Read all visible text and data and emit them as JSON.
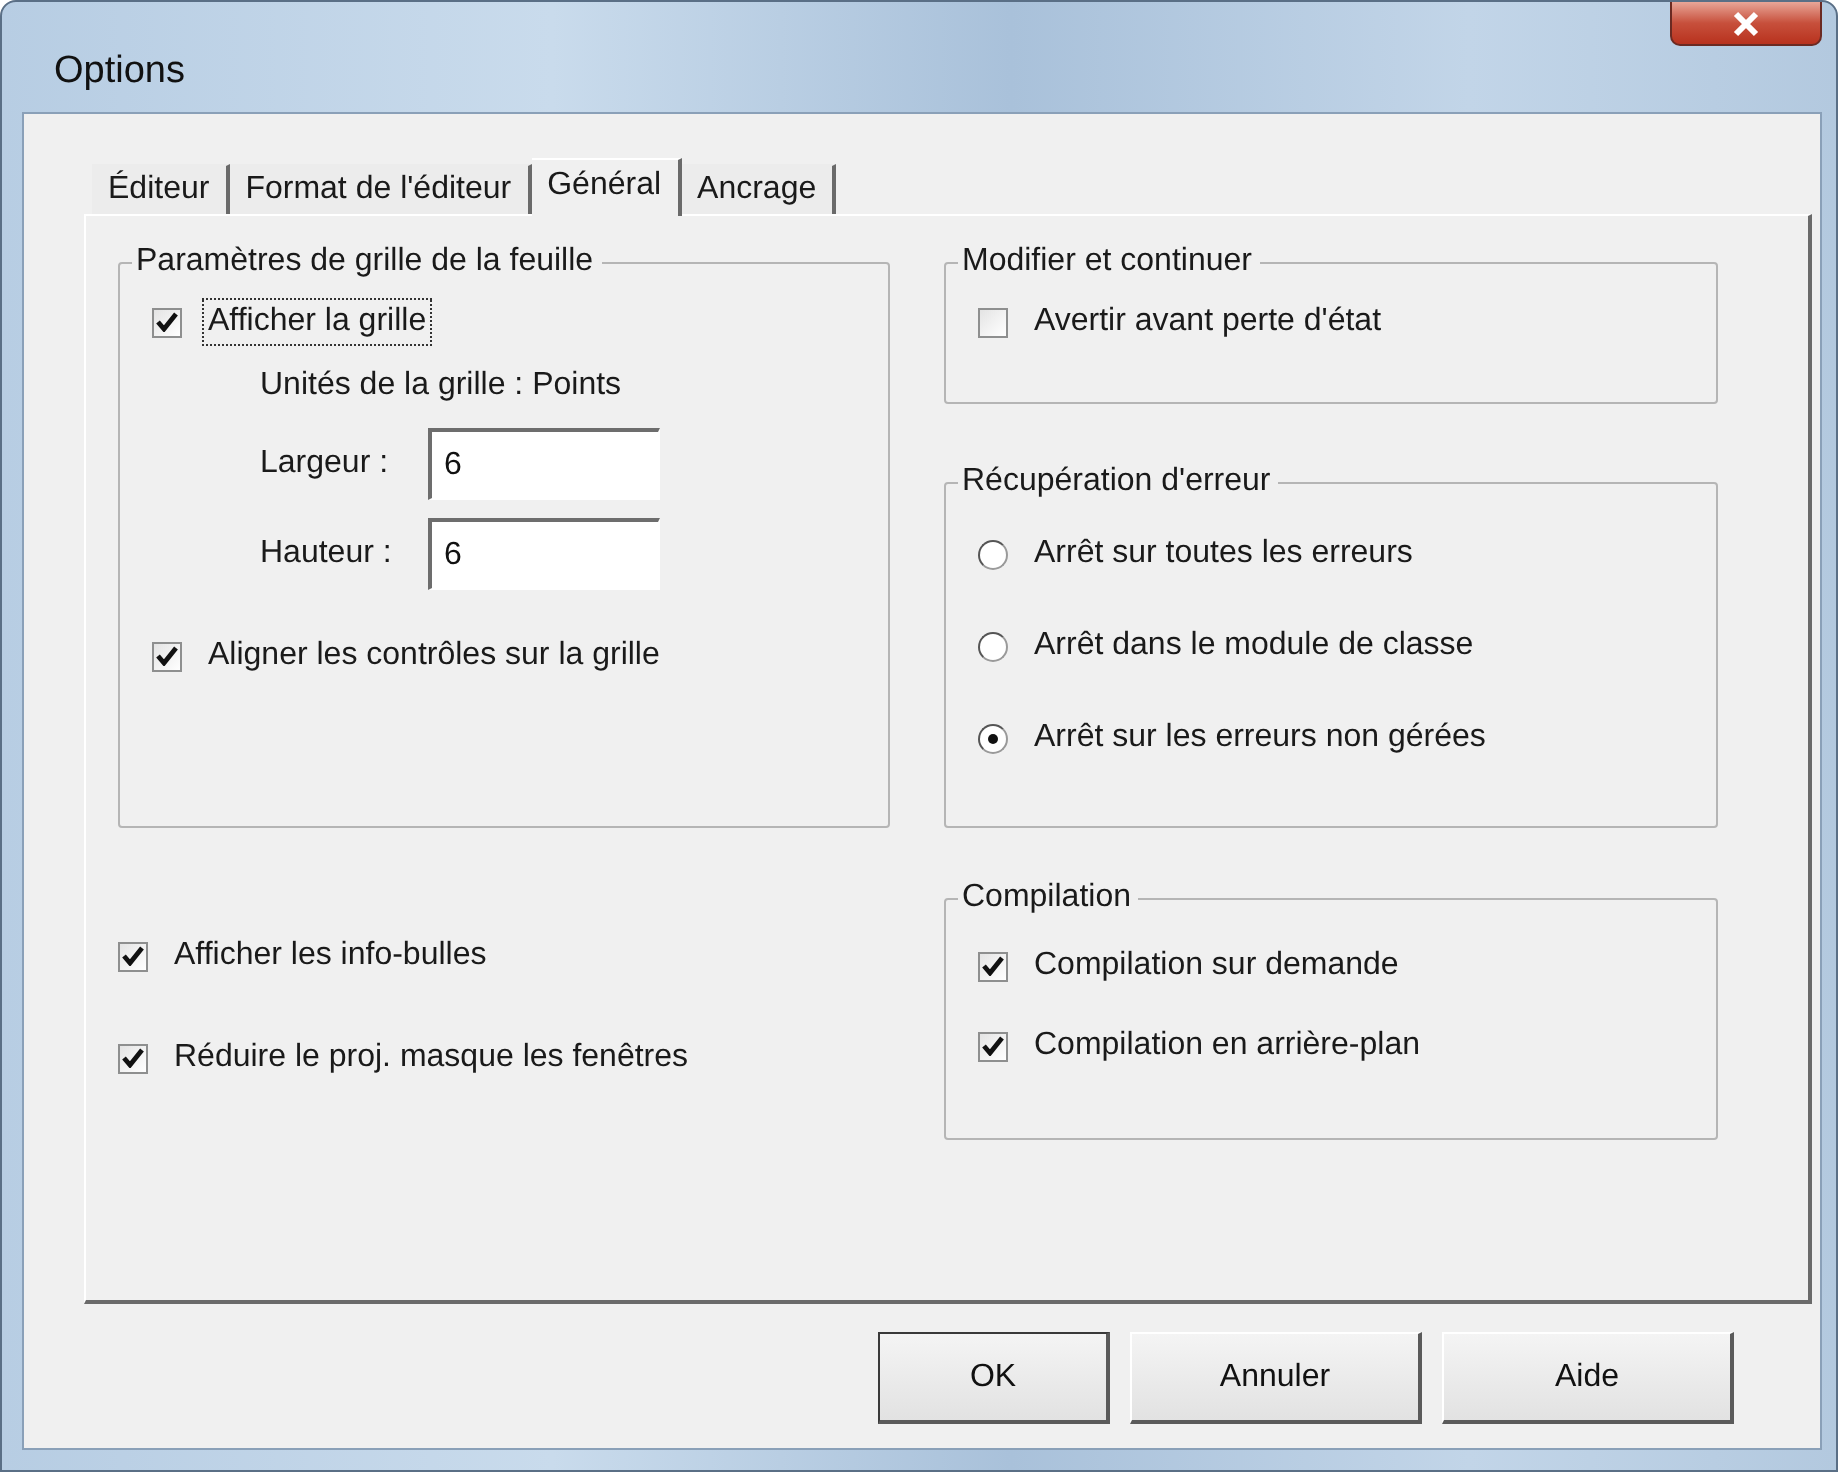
{
  "window": {
    "title": "Options"
  },
  "tabs": [
    {
      "label": "Éditeur",
      "selected": false
    },
    {
      "label": "Format de l'éditeur",
      "selected": false
    },
    {
      "label": "Général",
      "selected": true
    },
    {
      "label": "Ancrage",
      "selected": false
    }
  ],
  "grid_group": {
    "title": "Paramètres de grille de la feuille",
    "show_grid": {
      "label": "Afficher la grille",
      "checked": true,
      "focused": true
    },
    "units": "Unités de la grille : Points",
    "fields": [
      {
        "label": "Largeur :",
        "value": "6"
      },
      {
        "label": "Hauteur :",
        "value": "6"
      }
    ],
    "align": {
      "label": "Aligner les contrôles sur la grille",
      "checked": true
    }
  },
  "options": [
    {
      "label": "Afficher les info-bulles",
      "checked": true
    },
    {
      "label": "Réduire le proj. masque les fenêtres",
      "checked": true
    }
  ],
  "edit_continue": {
    "title": "Modifier et continuer",
    "checkboxes": [
      {
        "label": "Avertir avant perte d'état",
        "checked": false
      }
    ]
  },
  "error_trapping": {
    "title": "Récupération d'erreur",
    "radios": [
      {
        "label": "Arrêt sur toutes les erreurs",
        "selected": false
      },
      {
        "label": "Arrêt dans le module de classe",
        "selected": false
      },
      {
        "label": "Arrêt sur les erreurs non gérées",
        "selected": true
      }
    ]
  },
  "compilation": {
    "title": "Compilation",
    "checkboxes": [
      {
        "label": "Compilation sur demande",
        "checked": true
      },
      {
        "label": "Compilation en arrière-plan",
        "checked": true
      }
    ]
  },
  "buttons": [
    {
      "label": "OK",
      "default": true
    },
    {
      "label": "Annuler",
      "default": false
    },
    {
      "label": "Aide",
      "default": false
    }
  ]
}
